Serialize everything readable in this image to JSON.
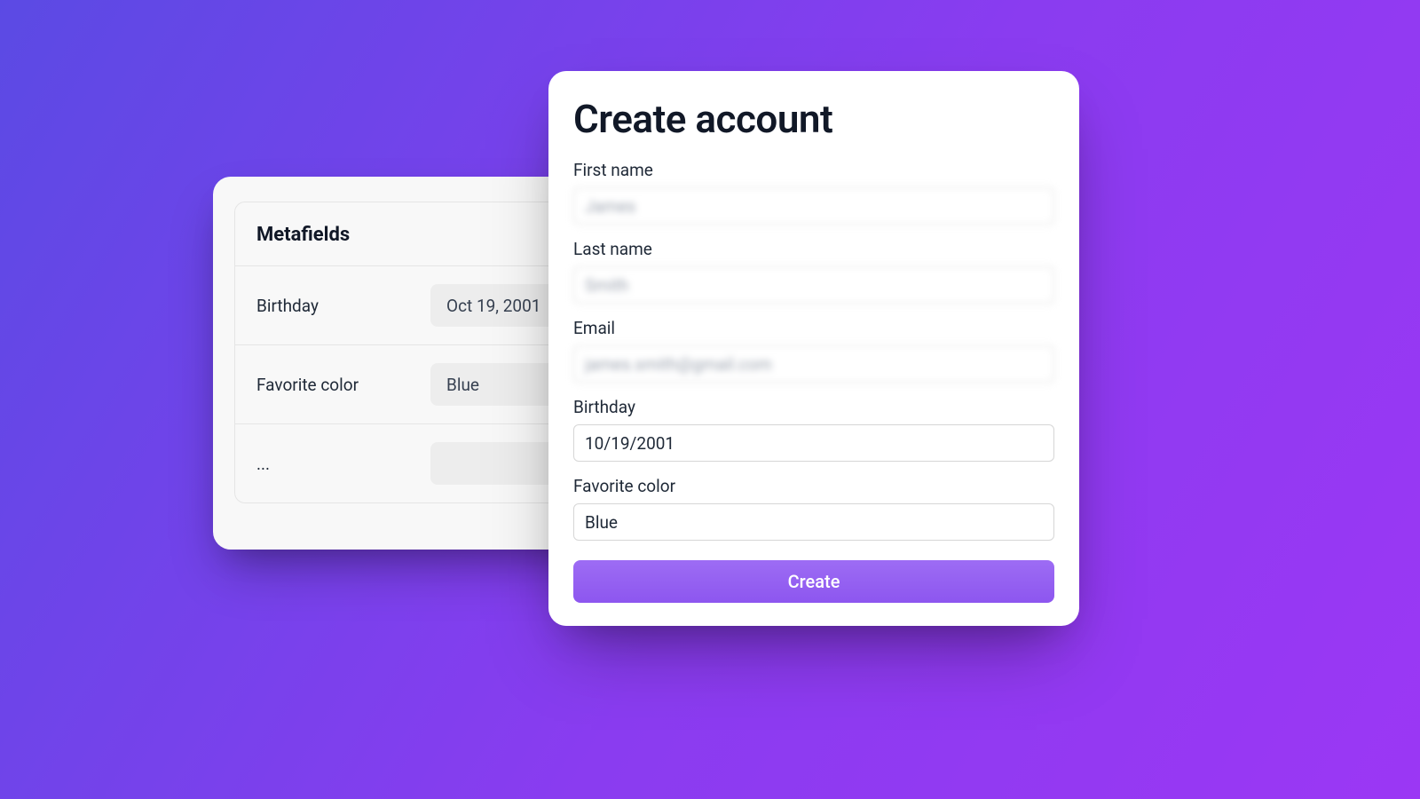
{
  "metafields": {
    "title": "Metafields",
    "rows": [
      {
        "label": "Birthday",
        "value": "Oct 19, 2001"
      },
      {
        "label": "Favorite color",
        "value": "Blue"
      },
      {
        "label": "...",
        "value": ""
      }
    ]
  },
  "account_form": {
    "title": "Create account",
    "fields": {
      "first_name": {
        "label": "First name",
        "value": "James"
      },
      "last_name": {
        "label": "Last name",
        "value": "Smith"
      },
      "email": {
        "label": "Email",
        "value": "james.smith@gmail.com"
      },
      "birthday": {
        "label": "Birthday",
        "value": "10/19/2001"
      },
      "favorite_color": {
        "label": "Favorite color",
        "value": "Blue"
      }
    },
    "submit_label": "Create"
  },
  "colors": {
    "accent": "#8d56ef",
    "bg_gradient_from": "#5b4ae4",
    "bg_gradient_to": "#9b37f4"
  }
}
